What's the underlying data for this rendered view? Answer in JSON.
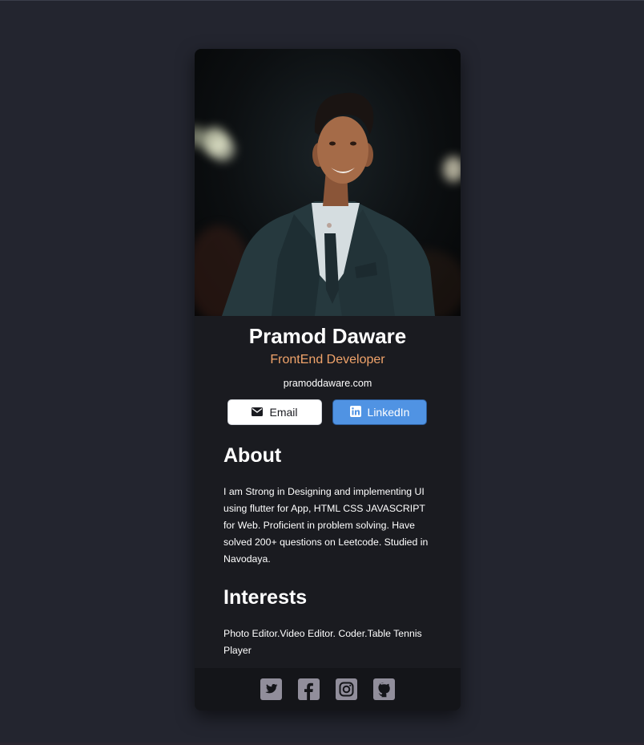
{
  "profile": {
    "name": "Pramod Daware",
    "role": "FrontEnd Developer",
    "website": "pramoddaware.com"
  },
  "buttons": {
    "email_label": "Email",
    "linkedin_label": "LinkedIn"
  },
  "about": {
    "title": "About",
    "body": "I am Strong in Designing and implementing UI using flutter for App, HTML CSS JAVASCRIPT for Web. Proficient in problem solving. Have solved 200+ questions on Leetcode. Studied in Navodaya."
  },
  "interests": {
    "title": "Interests",
    "body": "Photo Editor.Video Editor. Coder.Table Tennis Player"
  },
  "footer": {
    "icons": [
      "twitter-icon",
      "facebook-icon",
      "instagram-icon",
      "github-icon"
    ]
  },
  "colors": {
    "page_bg": "#23252f",
    "card_bg": "#1a1b20",
    "footer_bg": "#141519",
    "accent_orange": "#f0a36a",
    "linkedin_blue": "#5093e3",
    "icon_gray": "#918e9b"
  }
}
